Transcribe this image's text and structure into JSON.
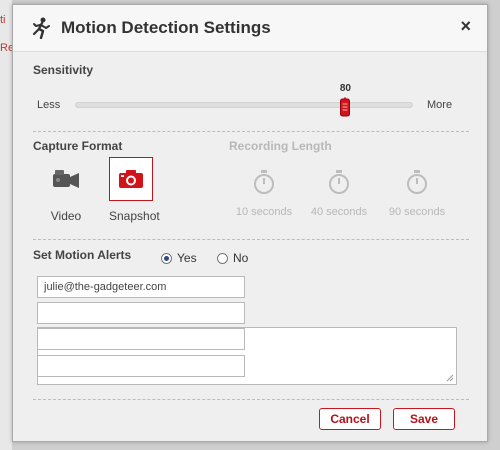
{
  "background_fragments": [
    "ti",
    "Re"
  ],
  "dialog": {
    "title": "Motion Detection Settings",
    "close_label": "×"
  },
  "sensitivity": {
    "label": "Sensitivity",
    "min_label": "Less",
    "max_label": "More",
    "value": 80,
    "value_text": "80"
  },
  "capture_format": {
    "label": "Capture Format",
    "options": [
      {
        "label": "Video",
        "icon": "video-camera-icon",
        "selected": false
      },
      {
        "label": "Snapshot",
        "icon": "camera-icon",
        "selected": true
      }
    ]
  },
  "recording_length": {
    "label": "Recording Length",
    "enabled": false,
    "options": [
      {
        "label": "10 seconds",
        "icon": "stopwatch-icon"
      },
      {
        "label": "40 seconds",
        "icon": "stopwatch-icon"
      },
      {
        "label": "90 seconds",
        "icon": "stopwatch-icon"
      }
    ]
  },
  "motion_alerts": {
    "label": "Set Motion Alerts",
    "yes_label": "Yes",
    "no_label": "No",
    "selected": "Yes",
    "emails": [
      "julie@the-gadgeteer.com",
      "",
      "",
      ""
    ]
  },
  "buttons": {
    "cancel": "Cancel",
    "save": "Save"
  },
  "colors": {
    "accent": "#c0161d",
    "radio_dot": "#2b4a8a"
  }
}
